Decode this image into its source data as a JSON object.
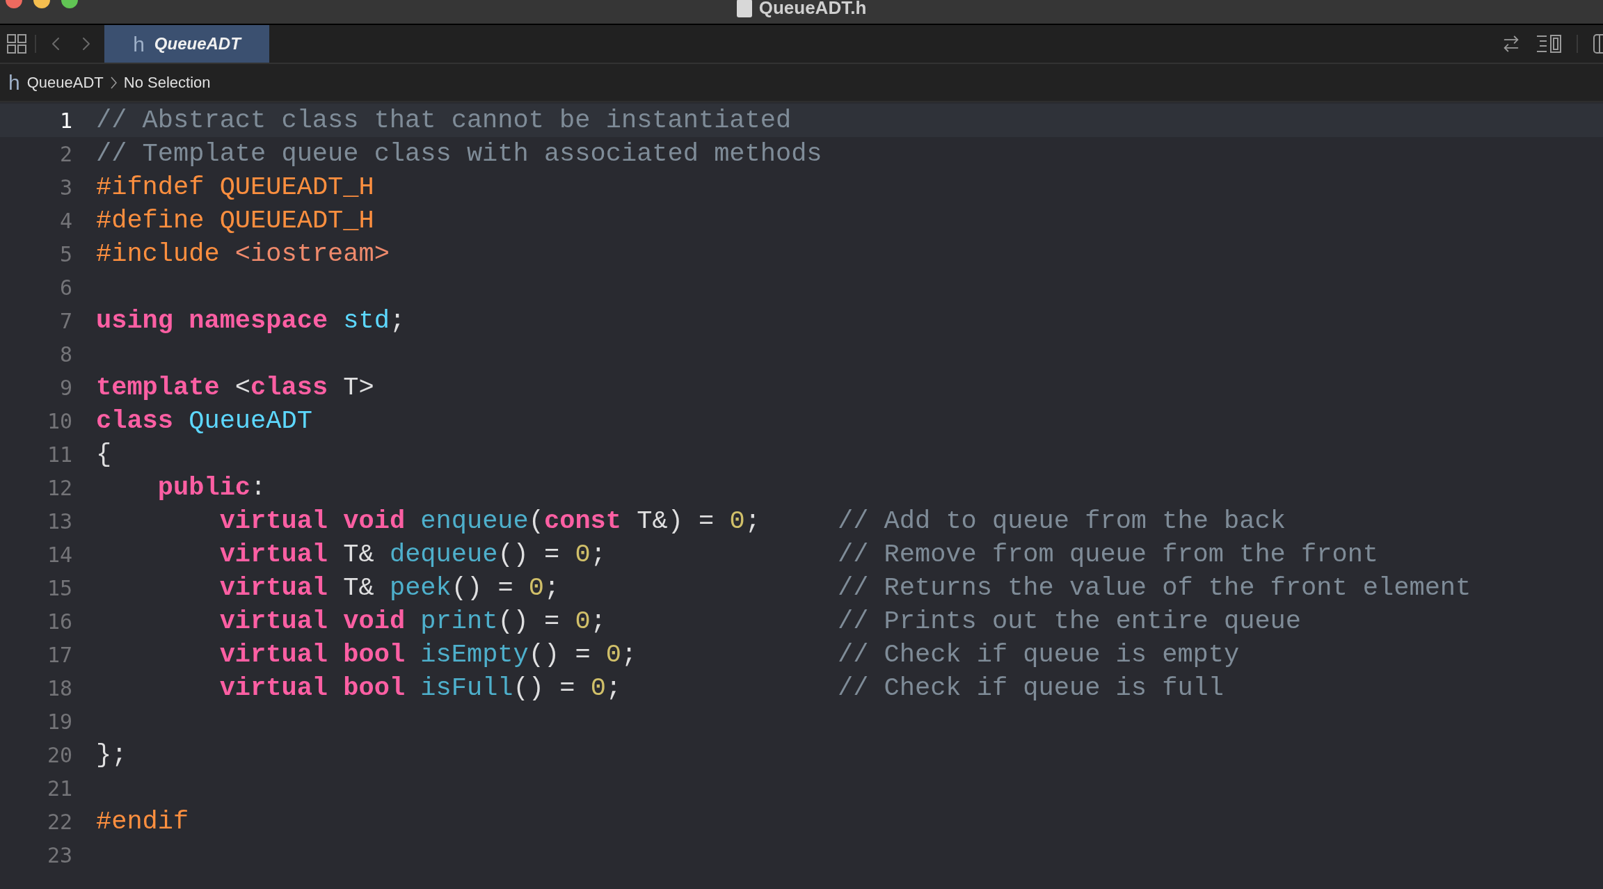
{
  "window": {
    "title": "QueueADT.h"
  },
  "toolbar": {
    "tabs": [
      {
        "icon_text": "h",
        "label": "QueueADT",
        "selected": true
      }
    ]
  },
  "breadcrumb": {
    "icon_text": "h",
    "items": [
      "QueueADT",
      "No Selection"
    ]
  },
  "editor": {
    "lines": [
      {
        "number": "1",
        "selected": true,
        "tokens": [
          {
            "kind": "comment",
            "text": "// Abstract class that cannot be instantiated"
          }
        ]
      },
      {
        "number": "2",
        "selected": false,
        "tokens": [
          {
            "kind": "comment",
            "text": "// Template queue class with associated methods"
          }
        ]
      },
      {
        "number": "3",
        "selected": false,
        "tokens": [
          {
            "kind": "preprocessor",
            "text": "#ifndef"
          },
          {
            "kind": "macro",
            "text": " QUEUEADT_H"
          }
        ]
      },
      {
        "number": "4",
        "selected": false,
        "tokens": [
          {
            "kind": "preprocessor",
            "text": "#define"
          },
          {
            "kind": "macro",
            "text": " QUEUEADT_H"
          }
        ]
      },
      {
        "number": "5",
        "selected": false,
        "tokens": [
          {
            "kind": "preprocessor",
            "text": "#include"
          },
          {
            "kind": "string",
            "text": " <iostream>"
          }
        ]
      },
      {
        "number": "6",
        "selected": false
      },
      {
        "number": "7",
        "selected": false,
        "tokens": [
          {
            "kind": "keyword",
            "text": "using"
          },
          {
            "kind": "keyword",
            "text": " namespace"
          },
          {
            "kind": "type",
            "text": " std"
          },
          {
            "kind": "plain",
            "text": ";"
          }
        ]
      },
      {
        "number": "8",
        "selected": false
      },
      {
        "number": "9",
        "selected": false,
        "tokens": [
          {
            "kind": "keyword",
            "text": "template"
          },
          {
            "kind": "plain",
            "text": " <"
          },
          {
            "kind": "keyword",
            "text": "class"
          },
          {
            "kind": "plain",
            "text": " T>"
          }
        ]
      },
      {
        "number": "10",
        "selected": false,
        "tokens": [
          {
            "kind": "keyword",
            "text": "class"
          },
          {
            "kind": "type",
            "text": " QueueADT"
          }
        ]
      },
      {
        "number": "11",
        "selected": false,
        "tokens": [
          {
            "kind": "plain",
            "text": "{"
          }
        ]
      },
      {
        "number": "12",
        "selected": false,
        "tokens": [
          {
            "kind": "keyword",
            "text": "    public"
          },
          {
            "kind": "plain",
            "text": ":"
          }
        ]
      },
      {
        "number": "13",
        "selected": false,
        "tokens": [
          {
            "kind": "keyword",
            "text": "        virtual"
          },
          {
            "kind": "keyword",
            "text": " void"
          },
          {
            "kind": "function",
            "text": " enqueue"
          },
          {
            "kind": "plain",
            "text": "("
          },
          {
            "kind": "keyword",
            "text": "const"
          },
          {
            "kind": "plain",
            "text": " T&) ="
          },
          {
            "kind": "number",
            "text": " 0"
          },
          {
            "kind": "plain",
            "text": ";"
          },
          {
            "kind": "comment",
            "text": "     // Add to queue from the back"
          }
        ]
      },
      {
        "number": "14",
        "selected": false,
        "tokens": [
          {
            "kind": "keyword",
            "text": "        virtual"
          },
          {
            "kind": "plain",
            "text": " T&"
          },
          {
            "kind": "function",
            "text": " dequeue"
          },
          {
            "kind": "plain",
            "text": "() ="
          },
          {
            "kind": "number",
            "text": " 0"
          },
          {
            "kind": "plain",
            "text": ";"
          },
          {
            "kind": "comment",
            "text": "               // Remove from queue from the front"
          }
        ]
      },
      {
        "number": "15",
        "selected": false,
        "tokens": [
          {
            "kind": "keyword",
            "text": "        virtual"
          },
          {
            "kind": "plain",
            "text": " T&"
          },
          {
            "kind": "function",
            "text": " peek"
          },
          {
            "kind": "plain",
            "text": "() ="
          },
          {
            "kind": "number",
            "text": " 0"
          },
          {
            "kind": "plain",
            "text": ";"
          },
          {
            "kind": "comment",
            "text": "                  // Returns the value of the front element"
          }
        ]
      },
      {
        "number": "16",
        "selected": false,
        "tokens": [
          {
            "kind": "keyword",
            "text": "        virtual"
          },
          {
            "kind": "keyword",
            "text": " void"
          },
          {
            "kind": "function",
            "text": " print"
          },
          {
            "kind": "plain",
            "text": "() ="
          },
          {
            "kind": "number",
            "text": " 0"
          },
          {
            "kind": "plain",
            "text": ";"
          },
          {
            "kind": "comment",
            "text": "               // Prints out the entire queue"
          }
        ]
      },
      {
        "number": "17",
        "selected": false,
        "tokens": [
          {
            "kind": "keyword",
            "text": "        virtual"
          },
          {
            "kind": "keyword",
            "text": " bool"
          },
          {
            "kind": "function",
            "text": " isEmpty"
          },
          {
            "kind": "plain",
            "text": "() ="
          },
          {
            "kind": "number",
            "text": " 0"
          },
          {
            "kind": "plain",
            "text": ";"
          },
          {
            "kind": "comment",
            "text": "             // Check if queue is empty"
          }
        ]
      },
      {
        "number": "18",
        "selected": false,
        "tokens": [
          {
            "kind": "keyword",
            "text": "        virtual"
          },
          {
            "kind": "keyword",
            "text": " bool"
          },
          {
            "kind": "function",
            "text": " isFull"
          },
          {
            "kind": "plain",
            "text": "() ="
          },
          {
            "kind": "number",
            "text": " 0"
          },
          {
            "kind": "plain",
            "text": ";"
          },
          {
            "kind": "comment",
            "text": "              // Check if queue is full"
          }
        ]
      },
      {
        "number": "19",
        "selected": false
      },
      {
        "number": "20",
        "selected": false,
        "tokens": [
          {
            "kind": "plain",
            "text": "};"
          }
        ]
      },
      {
        "number": "21",
        "selected": false
      },
      {
        "number": "22",
        "selected": false,
        "tokens": [
          {
            "kind": "preprocessor",
            "text": "#endif"
          }
        ]
      },
      {
        "number": "23",
        "selected": false
      }
    ]
  }
}
